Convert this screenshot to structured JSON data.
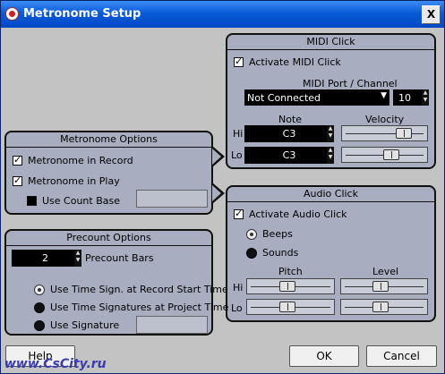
{
  "window": {
    "title": "Metronome Setup",
    "close_label": "X"
  },
  "midi_click": {
    "title": "MIDI Click",
    "activate_label": "Activate MIDI Click",
    "port_channel_label": "MIDI Port / Channel",
    "port_value": "Not Connected",
    "channel_value": "10",
    "note_label": "Note",
    "velocity_label": "Velocity",
    "hi_label": "Hi",
    "lo_label": "Lo",
    "hi_note": "C3",
    "lo_note": "C3",
    "hi_velocity_level": 0.8,
    "lo_velocity_level": 0.6
  },
  "metronome_options": {
    "title": "Metronome Options",
    "in_record_label": "Metronome in Record",
    "in_play_label": "Metronome in Play",
    "count_base_label": "Use Count Base"
  },
  "audio_click": {
    "title": "Audio Click",
    "activate_label": "Activate Audio Click",
    "beeps_label": "Beeps",
    "sounds_label": "Sounds",
    "pitch_label": "Pitch",
    "level_label": "Level",
    "hi_label": "Hi",
    "lo_label": "Lo",
    "hi_pitch_level": 0.45,
    "lo_pitch_level": 0.45,
    "hi_level": 0.45,
    "lo_level": 0.45
  },
  "precount_options": {
    "title": "Precount Options",
    "bars_value": "2",
    "bars_label": "Precount Bars",
    "opt1_label": "Use Time Sign. at Record Start Time",
    "opt2_label": "Use Time Signatures at Project Time",
    "opt3_label": "Use Signature"
  },
  "buttons": {
    "help": "Help",
    "ok": "OK",
    "cancel": "Cancel"
  },
  "watermark": "www.CsCity.ru",
  "colors": {
    "title_bar": "#0a5bd8",
    "panel_bg": "#a8aec0",
    "window_bg": "#c3c3c3"
  }
}
